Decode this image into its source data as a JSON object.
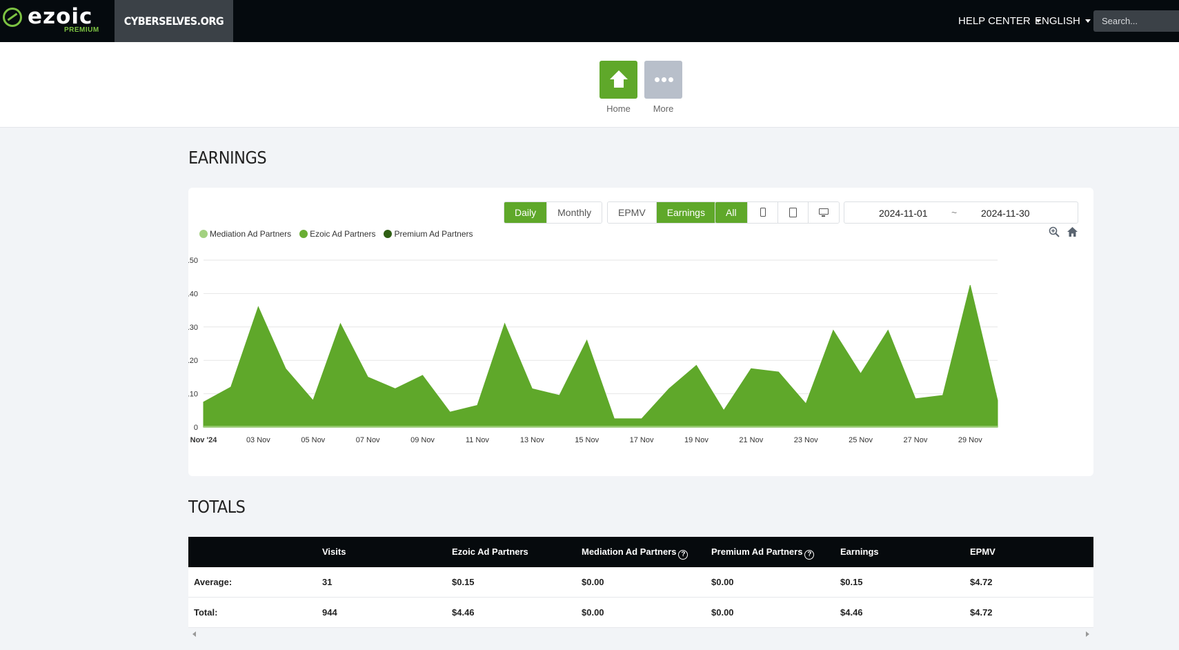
{
  "header": {
    "logo_text": "ezoic",
    "logo_sub": "PREMIUM",
    "site_name": "CYBERSELVES.ORG",
    "help_center": "HELP CENTER",
    "language": "ENGLISH",
    "search_placeholder": "Search..."
  },
  "apps": [
    {
      "label": "Home",
      "icon": "home-icon"
    },
    {
      "label": "More",
      "icon": "more-dots-icon"
    }
  ],
  "earnings": {
    "title": "EARNINGS",
    "period_buttons": [
      "Daily",
      "Monthly"
    ],
    "active_period": "Daily",
    "metric_buttons": [
      "EPMV",
      "Earnings"
    ],
    "active_metric": "Earnings",
    "device_all": "All",
    "device_icons": [
      "phone-icon",
      "tablet-icon",
      "desktop-icon"
    ],
    "date_start": "2024-11-01",
    "date_sep": "~",
    "date_end": "2024-11-30"
  },
  "colors": {
    "accent": "#5fa82a",
    "mediation": "#a3d180",
    "ezoic": "#6aae34",
    "premium": "#2f5f14"
  },
  "chart_data": {
    "type": "area",
    "legend": [
      "Mediation Ad Partners",
      "Ezoic Ad Partners",
      "Premium Ad Partners"
    ],
    "legend_placement": "top-left",
    "grid": true,
    "ylim": [
      0,
      0.5
    ],
    "yticks": [
      "0",
      "0.10",
      "0.20",
      "0.30",
      "0.40",
      "0.50"
    ],
    "xticks": [
      "Nov '24",
      "03 Nov",
      "05 Nov",
      "07 Nov",
      "09 Nov",
      "11 Nov",
      "13 Nov",
      "15 Nov",
      "17 Nov",
      "19 Nov",
      "21 Nov",
      "23 Nov",
      "25 Nov",
      "27 Nov",
      "29 Nov"
    ],
    "x": [
      "2024-11-01",
      "2024-11-02",
      "2024-11-03",
      "2024-11-04",
      "2024-11-05",
      "2024-11-06",
      "2024-11-07",
      "2024-11-08",
      "2024-11-09",
      "2024-11-10",
      "2024-11-11",
      "2024-11-12",
      "2024-11-13",
      "2024-11-14",
      "2024-11-15",
      "2024-11-16",
      "2024-11-17",
      "2024-11-18",
      "2024-11-19",
      "2024-11-20",
      "2024-11-21",
      "2024-11-22",
      "2024-11-23",
      "2024-11-24",
      "2024-11-25",
      "2024-11-26",
      "2024-11-27",
      "2024-11-28",
      "2024-11-29",
      "2024-11-30"
    ],
    "series": [
      {
        "name": "Ezoic Ad Partners",
        "values": [
          0.075,
          0.12,
          0.36,
          0.175,
          0.08,
          0.31,
          0.15,
          0.115,
          0.155,
          0.045,
          0.065,
          0.31,
          0.115,
          0.095,
          0.26,
          0.025,
          0.025,
          0.115,
          0.185,
          0.05,
          0.175,
          0.165,
          0.07,
          0.29,
          0.16,
          0.29,
          0.085,
          0.095,
          0.425,
          0.08
        ]
      },
      {
        "name": "Mediation Ad Partners",
        "values": [
          0,
          0,
          0,
          0,
          0,
          0,
          0,
          0,
          0,
          0,
          0,
          0,
          0,
          0,
          0,
          0,
          0,
          0,
          0,
          0,
          0,
          0,
          0,
          0,
          0,
          0,
          0,
          0,
          0,
          0
        ]
      },
      {
        "name": "Premium Ad Partners",
        "values": [
          0,
          0,
          0,
          0,
          0,
          0,
          0,
          0,
          0,
          0,
          0,
          0,
          0,
          0,
          0,
          0,
          0,
          0,
          0,
          0,
          0,
          0,
          0,
          0,
          0,
          0,
          0,
          0,
          0,
          0
        ]
      }
    ]
  },
  "totals": {
    "title": "TOTALS",
    "columns": [
      "",
      "Visits",
      "Ezoic Ad Partners",
      "Mediation Ad Partners",
      "Premium Ad Partners",
      "Earnings",
      "EPMV"
    ],
    "help_columns": [
      3,
      4
    ],
    "rows": [
      [
        "Average:",
        "31",
        "$0.15",
        "$0.00",
        "$0.00",
        "$0.15",
        "$4.72"
      ],
      [
        "Total:",
        "944",
        "$4.46",
        "$0.00",
        "$0.00",
        "$4.46",
        "$4.72"
      ]
    ]
  }
}
